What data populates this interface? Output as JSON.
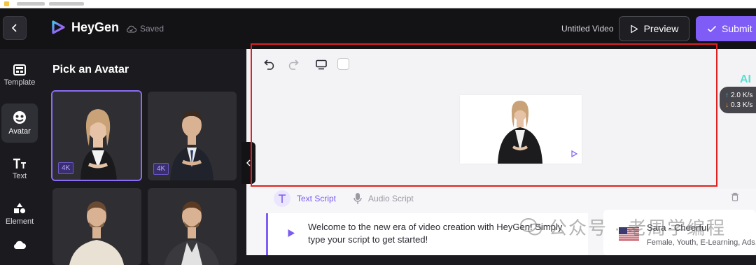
{
  "header": {
    "logo_text": "HeyGen",
    "saved_label": "Saved",
    "video_title": "Untitled Video",
    "preview_label": "Preview",
    "submit_label": "Submit"
  },
  "rail": {
    "items": [
      {
        "label": "Template",
        "icon": "template-icon"
      },
      {
        "label": "Avatar",
        "icon": "avatar-icon"
      },
      {
        "label": "Text",
        "icon": "text-icon"
      },
      {
        "label": "Element",
        "icon": "element-icon"
      }
    ]
  },
  "panel": {
    "title": "Pick an Avatar",
    "avatars": [
      {
        "badge": "4K",
        "selected": true
      },
      {
        "badge": "4K",
        "selected": false
      },
      {
        "badge": "",
        "selected": false
      },
      {
        "badge": "",
        "selected": false
      }
    ]
  },
  "canvas": {
    "tools": [
      "undo-icon",
      "redo-icon",
      "screen-ratio-icon",
      "background-color-swatch"
    ]
  },
  "network": {
    "ai_label": "AI",
    "upload": "2.0",
    "download": "0.3",
    "unit": "K/s"
  },
  "script": {
    "tab_text": "Text Script",
    "tab_audio": "Audio Script",
    "text": "Welcome to the new era of video creation with HeyGen! Simply type your script to get started!"
  },
  "voice": {
    "name": "Sara - Cheerful",
    "tags": "Female, Youth, E-Learning, Ads,"
  },
  "watermark": {
    "text": "公众号 · 老周学编程"
  },
  "colors": {
    "accent": "#7f5cf5",
    "header_bg": "#131316",
    "highlight_frame": "#e02020"
  }
}
